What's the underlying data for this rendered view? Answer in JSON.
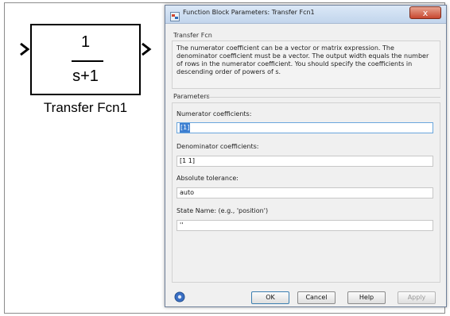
{
  "block": {
    "numerator": "1",
    "denominator": "s+1",
    "name": "Transfer Fcn1"
  },
  "dialog": {
    "title": "Function Block Parameters: Transfer Fcn1",
    "close_glyph": "x",
    "section_title": "Transfer Fcn",
    "description": "The numerator coefficient can be a vector or matrix expression. The denominator coefficient must be a vector. The output width equals the number of rows in the numerator coefficient. You should specify the coefficients in descending order of powers of s.",
    "parameters_label": "Parameters",
    "fields": [
      {
        "label": "Numerator coefficients:",
        "value": "[1]"
      },
      {
        "label": "Denominator coefficients:",
        "value": "[1 1]"
      },
      {
        "label": "Absolute tolerance:",
        "value": "auto"
      },
      {
        "label": "State Name: (e.g., 'position')",
        "value": "''"
      }
    ],
    "buttons": {
      "ok": "OK",
      "cancel": "Cancel",
      "help": "Help",
      "apply": "Apply"
    }
  }
}
